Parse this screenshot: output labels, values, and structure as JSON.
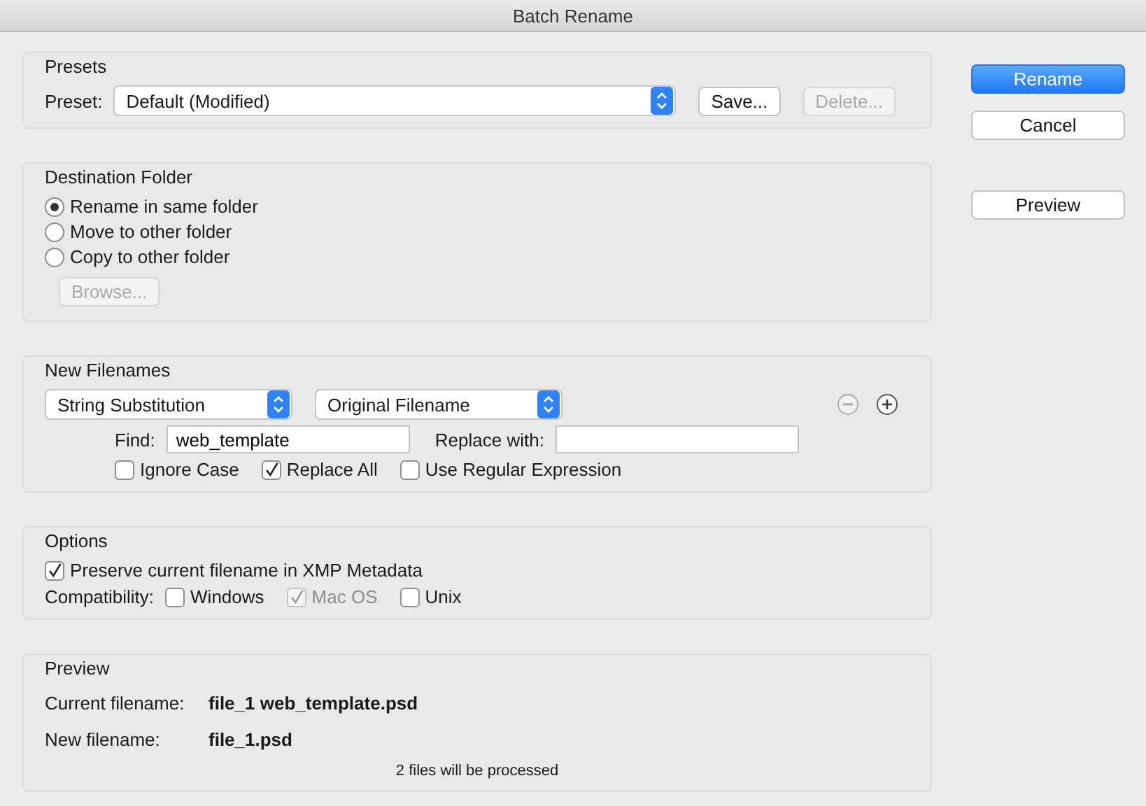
{
  "window": {
    "title": "Batch Rename"
  },
  "presets": {
    "title": "Presets",
    "label": "Preset:",
    "value": "Default (Modified)",
    "buttons": [
      {
        "label": "Save...",
        "disabled": false
      },
      {
        "label": "Delete...",
        "disabled": true
      }
    ]
  },
  "destination": {
    "title": "Destination Folder",
    "options": [
      {
        "label": "Rename in same folder",
        "selected": true
      },
      {
        "label": "Move to other folder",
        "selected": false
      },
      {
        "label": "Copy to other folder",
        "selected": false
      }
    ],
    "browse": {
      "label": "Browse...",
      "disabled": true
    }
  },
  "new_filenames": {
    "title": "New Filenames",
    "selects": [
      "String Substitution",
      "Original Filename"
    ],
    "remove_disabled": true,
    "find": {
      "label": "Find:",
      "value": "web_template"
    },
    "replace": {
      "label": "Replace with:"
    },
    "checkboxes": [
      {
        "label": "Ignore Case",
        "checked": false
      },
      {
        "label": "Replace All",
        "checked": true
      },
      {
        "label": "Use Regular Expression",
        "checked": false
      }
    ]
  },
  "options": {
    "title": "Options",
    "preserve": {
      "label": "Preserve current filename in XMP Metadata",
      "checked": true
    },
    "compat_label": "Compatibility:",
    "compat": [
      {
        "label": "Windows",
        "checked": false,
        "disabled": false
      },
      {
        "label": "Mac OS",
        "checked": true,
        "disabled": true
      },
      {
        "label": "Unix",
        "checked": false,
        "disabled": false
      }
    ]
  },
  "preview": {
    "title": "Preview",
    "rows": [
      {
        "label": "Current filename:",
        "value": "file_1 web_template.psd"
      },
      {
        "label": "New filename:",
        "value": "file_1.psd"
      }
    ],
    "summary": "2 files will be processed"
  },
  "buttons": [
    {
      "label": "Rename",
      "kind": "primary"
    },
    {
      "label": "Cancel",
      "kind": "normal"
    },
    {
      "label": "Preview",
      "kind": "spaced"
    }
  ]
}
